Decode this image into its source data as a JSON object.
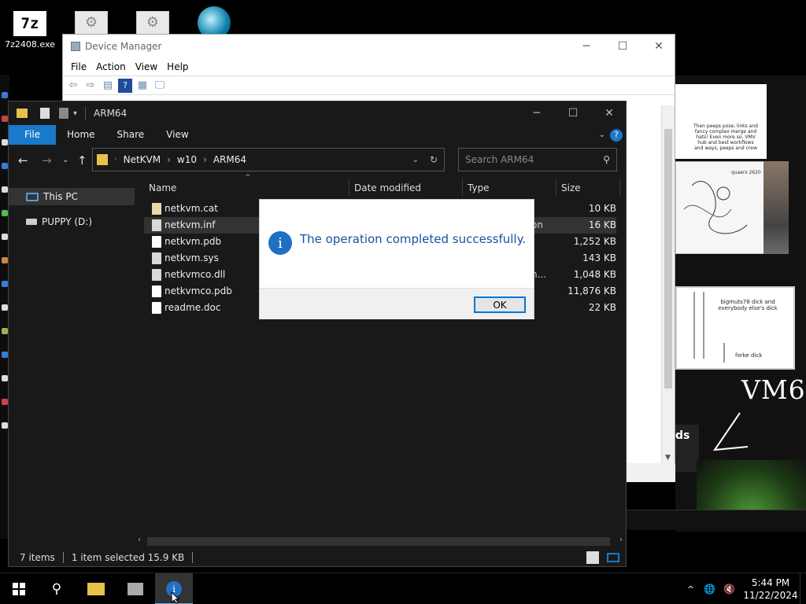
{
  "desktop": {
    "icons": [
      {
        "label": "7z2408.exe",
        "glyph": "7z"
      },
      {
        "label": "",
        "glyph": "⚙"
      },
      {
        "label": "",
        "glyph": "⚙"
      },
      {
        "label": "",
        "glyph": ""
      }
    ],
    "doodle": {
      "note1": "Then peeps pose, links and fancy complex merge and hats! Even more so, VMV hub and best workflows and ways, peeps and crew",
      "sketch_text": "quaers 2620",
      "note2_line1": "bigmuts78 dick and everybody else's dick",
      "note2_line2": "forke dick",
      "vm6": "VM6",
      "partial": "ds"
    }
  },
  "device_manager": {
    "title": "Device Manager",
    "menu": [
      "File",
      "Action",
      "View",
      "Help"
    ]
  },
  "explorer": {
    "title": "ARM64",
    "ribbon_tabs": [
      "File",
      "Home",
      "Share",
      "View"
    ],
    "breadcrumb": [
      "NetKVM",
      "w10",
      "ARM64"
    ],
    "search_placeholder": "Search ARM64",
    "nav": [
      {
        "label": "This PC",
        "icon": "computer-icon"
      },
      {
        "label": "PUPPY (D:)",
        "icon": "drive-icon"
      }
    ],
    "columns": [
      "Name",
      "Date modified",
      "Type",
      "Size"
    ],
    "files": [
      {
        "name": "netkvm.cat",
        "type": "",
        "size": "10 KB",
        "selected": false
      },
      {
        "name": "netkvm.inf",
        "type": "on",
        "size": "16 KB",
        "selected": true
      },
      {
        "name": "netkvm.pdb",
        "type": "",
        "size": "1,252 KB",
        "selected": false
      },
      {
        "name": "netkvm.sys",
        "type": "",
        "size": "143 KB",
        "selected": false
      },
      {
        "name": "netkvmco.dll",
        "type": "n...",
        "size": "1,048 KB",
        "selected": false
      },
      {
        "name": "netkvmco.pdb",
        "type": "",
        "size": "11,876 KB",
        "selected": false
      },
      {
        "name": "readme.doc",
        "type": "",
        "size": "22 KB",
        "selected": false
      }
    ],
    "status": {
      "items": "7 items",
      "selected": "1 item selected  15.9 KB"
    }
  },
  "dialog": {
    "message": "The operation completed successfully.",
    "ok": "OK"
  },
  "taskbar": {
    "time": "5:44 PM",
    "date": "11/22/2024"
  },
  "colors": {
    "accent": "#1979ca",
    "dialog_text": "#1a4f9e"
  }
}
